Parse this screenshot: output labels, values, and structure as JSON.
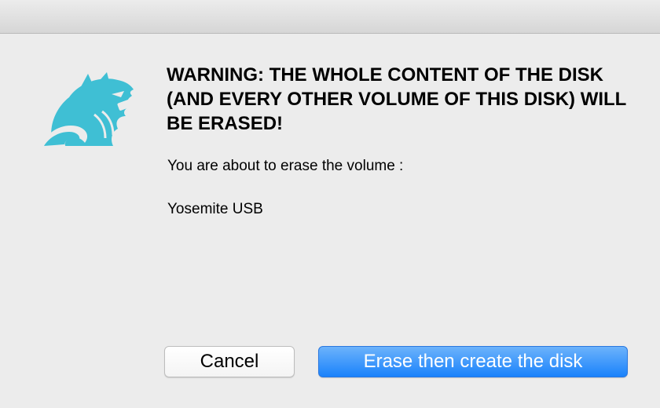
{
  "dialog": {
    "headline": "WARNING: THE WHOLE CONTENT OF THE DISK (AND EVERY OTHER VOLUME OF THIS DISK) WILL BE ERASED!",
    "intro": "You are about to erase the volume :",
    "volume_name": "Yosemite USB",
    "cancel_label": "Cancel",
    "confirm_label": "Erase then create the disk",
    "icon": "app-logo-icon"
  },
  "colors": {
    "logo": "#3fbfd4",
    "primary_button": "#1a82fb",
    "background": "#ececec"
  }
}
